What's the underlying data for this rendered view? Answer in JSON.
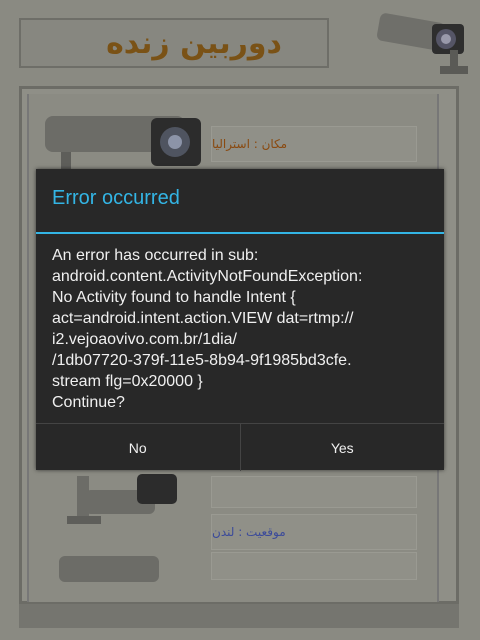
{
  "app": {
    "title": "دوربین زنده",
    "rows": [
      {
        "label": "مکان : استرالیا"
      },
      {
        "label": ""
      },
      {
        "label": ""
      },
      {
        "label": "موقعیت : لندن"
      }
    ]
  },
  "dialog": {
    "title": "Error occurred",
    "message": "An error has occurred in sub:\nandroid.content.ActivityNotFoundException:\nNo Activity found to handle Intent {\nact=android.intent.action.VIEW dat=rtmp://\ni2.vejoaovivo.com.br/1dia/\n/1db07720-379f-11e5-8b94-9f1985bd3cfe.\nstream flg=0x20000 }\nContinue?",
    "no_label": "No",
    "yes_label": "Yes"
  },
  "colors": {
    "accent": "#33b5e5",
    "dialog_bg": "#282828",
    "title_text": "#7a5216"
  }
}
